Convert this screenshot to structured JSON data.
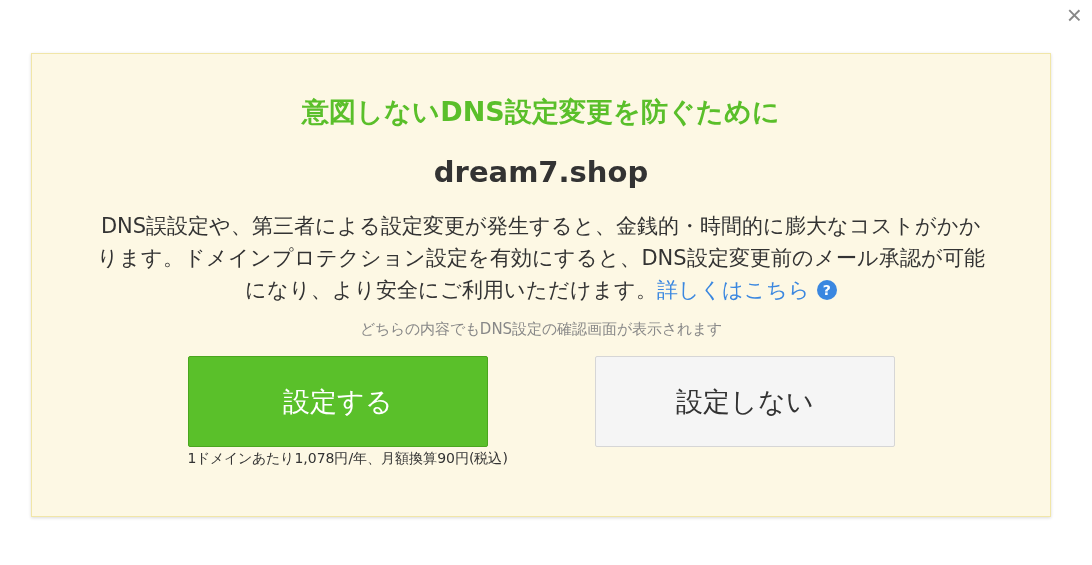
{
  "close_button": "×",
  "dialog": {
    "title": "意図しないDNS設定変更を防ぐために",
    "domain": "dream7.shop",
    "description": "DNS誤設定や、第三者による設定変更が発生すると、金銭的・時間的に膨大なコストがかかります。ドメインプロテクション設定を有効にすると、DNS設定変更前のメール承認が可能になり、より安全にご利用いただけます。",
    "link": "詳しくはこちら",
    "help_icon": "?",
    "note": "どちらの内容でもDNS設定の確認画面が表示されます",
    "buttons": [
      {
        "label": "設定する",
        "kind": "primary",
        "caption": "1ドメインあたり1,078円/年、月額換算90円(税込)"
      },
      {
        "label": "設定しない",
        "kind": "secondary"
      }
    ]
  }
}
